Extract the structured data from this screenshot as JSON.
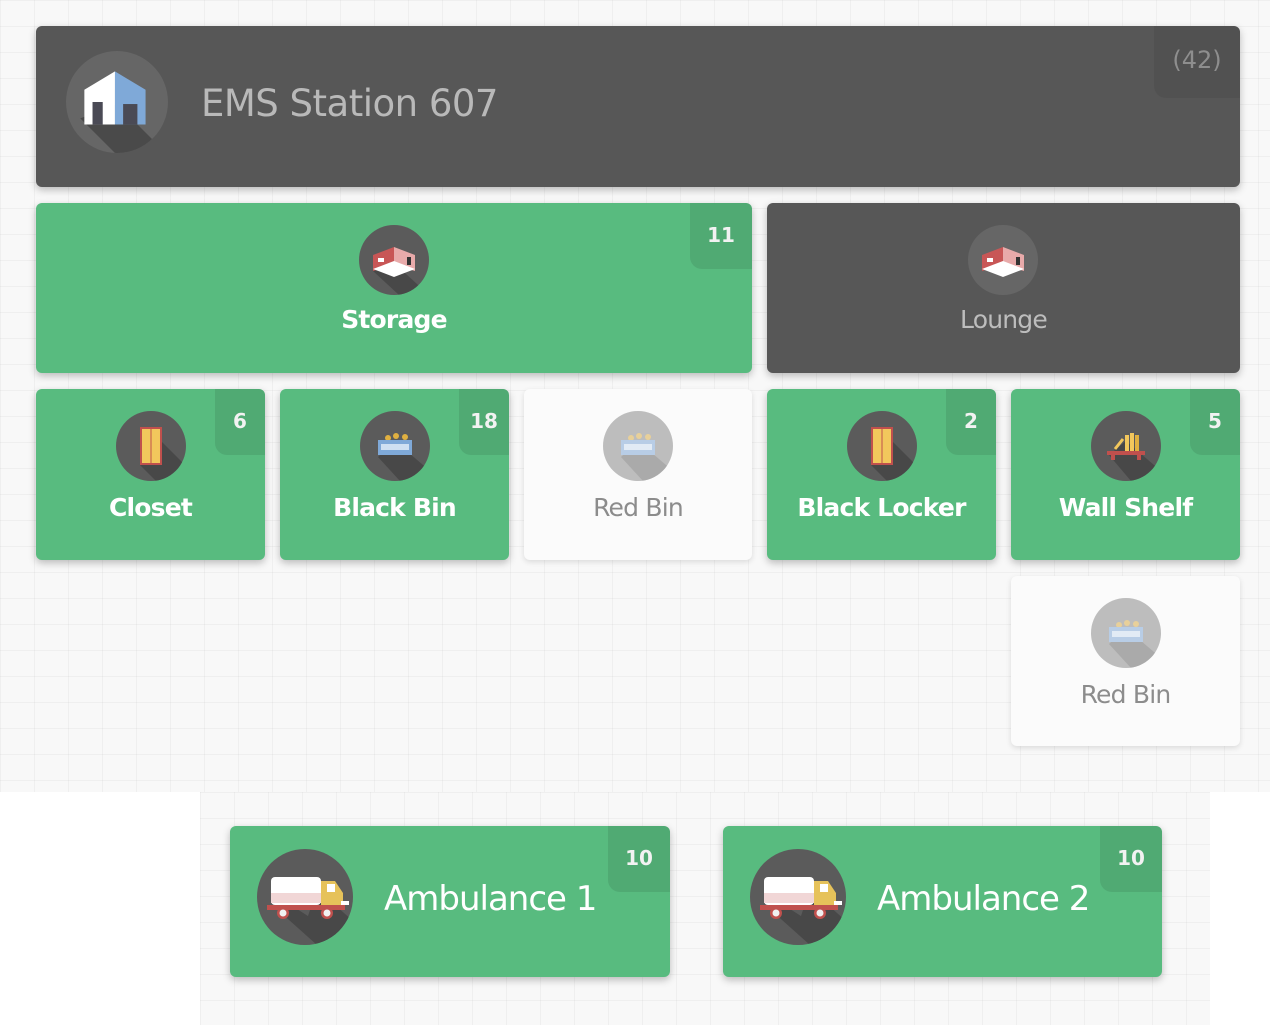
{
  "station": {
    "title": "EMS Station 607",
    "count": "(42)",
    "icon": "building-icon"
  },
  "rooms": [
    {
      "label": "Storage",
      "count": "11",
      "icon": "room-icon",
      "status": "active"
    },
    {
      "label": "Lounge",
      "count": "",
      "icon": "room-icon",
      "status": "inactive"
    }
  ],
  "containers": [
    {
      "label": "Closet",
      "count": "6",
      "icon": "closet-icon",
      "status": "active"
    },
    {
      "label": "Black Bin",
      "count": "18",
      "icon": "bin-icon",
      "status": "active"
    },
    {
      "label": "Red Bin",
      "count": "",
      "icon": "bin-icon",
      "status": "empty"
    },
    {
      "label": "Black Locker",
      "count": "2",
      "icon": "locker-icon",
      "status": "active"
    },
    {
      "label": "Wall Shelf",
      "count": "5",
      "icon": "shelf-icon",
      "status": "active"
    },
    {
      "label": "Red Bin",
      "count": "",
      "icon": "bin-icon",
      "status": "empty"
    }
  ],
  "vehicles": [
    {
      "label": "Ambulance 1",
      "count": "10",
      "icon": "truck-icon"
    },
    {
      "label": "Ambulance 2",
      "count": "10",
      "icon": "truck-icon"
    }
  ],
  "colors": {
    "active": "#58bb7f",
    "inactive": "#575757",
    "empty": "#fbfbfb"
  }
}
